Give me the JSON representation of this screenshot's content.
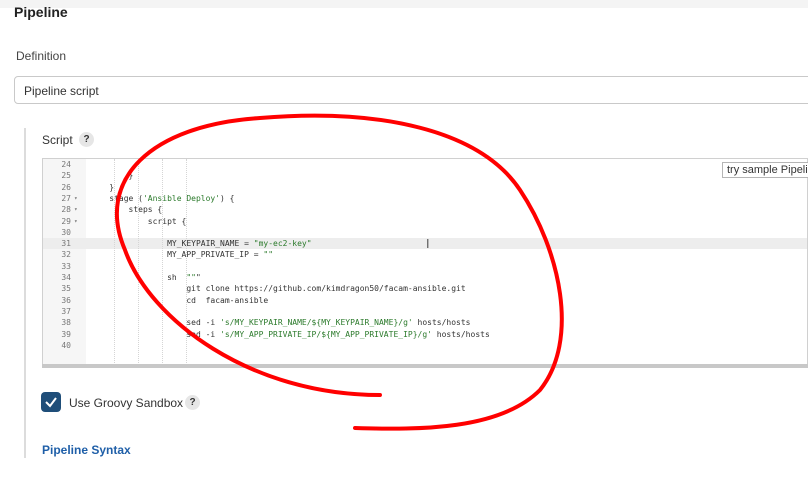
{
  "section": {
    "title": "Pipeline"
  },
  "definition": {
    "label": "Definition",
    "selected": "Pipeline script"
  },
  "script": {
    "label": "Script",
    "help": "?",
    "lines": [
      {
        "n": "24",
        "fold": "",
        "code": ""
      },
      {
        "n": "25",
        "fold": "",
        "code": "        }"
      },
      {
        "n": "26",
        "fold": "",
        "code": "    }"
      },
      {
        "n": "27",
        "fold": "▾",
        "code": "    stage ('Ansible Deploy') {"
      },
      {
        "n": "28",
        "fold": "▾",
        "code": "        steps {"
      },
      {
        "n": "29",
        "fold": "▾",
        "code": "            script {"
      },
      {
        "n": "30",
        "fold": "",
        "code": ""
      },
      {
        "n": "31",
        "fold": "",
        "code": "                MY_KEYPAIR_NAME = \"my-ec2-key\""
      },
      {
        "n": "32",
        "fold": "",
        "code": "                MY_APP_PRIVATE_IP = \"\""
      },
      {
        "n": "33",
        "fold": "",
        "code": ""
      },
      {
        "n": "34",
        "fold": "",
        "code": "                sh  \"\"\""
      },
      {
        "n": "35",
        "fold": "",
        "code": "                    git clone https://github.com/kimdragon50/facam-ansible.git"
      },
      {
        "n": "36",
        "fold": "",
        "code": "                    cd  facam-ansible"
      },
      {
        "n": "37",
        "fold": "",
        "code": ""
      },
      {
        "n": "38",
        "fold": "",
        "code": "                    sed -i 's/MY_KEYPAIR_NAME/${MY_KEYPAIR_NAME}/g' hosts/hosts"
      },
      {
        "n": "39",
        "fold": "",
        "code": "                    sed -i 's/MY_APP_PRIVATE_IP/${MY_APP_PRIVATE_IP}/g' hosts/hosts"
      },
      {
        "n": "40",
        "fold": "",
        "code": ""
      }
    ],
    "active_line": "31",
    "try_sample": "try sample Pipeline..."
  },
  "sandbox": {
    "label": "Use Groovy Sandbox",
    "checked": true,
    "help": "?"
  },
  "links": {
    "pipeline_syntax": "Pipeline Syntax"
  },
  "colors": {
    "accent": "#1f4e79",
    "link": "#1f5fa8",
    "annotation": "#ff0000"
  }
}
